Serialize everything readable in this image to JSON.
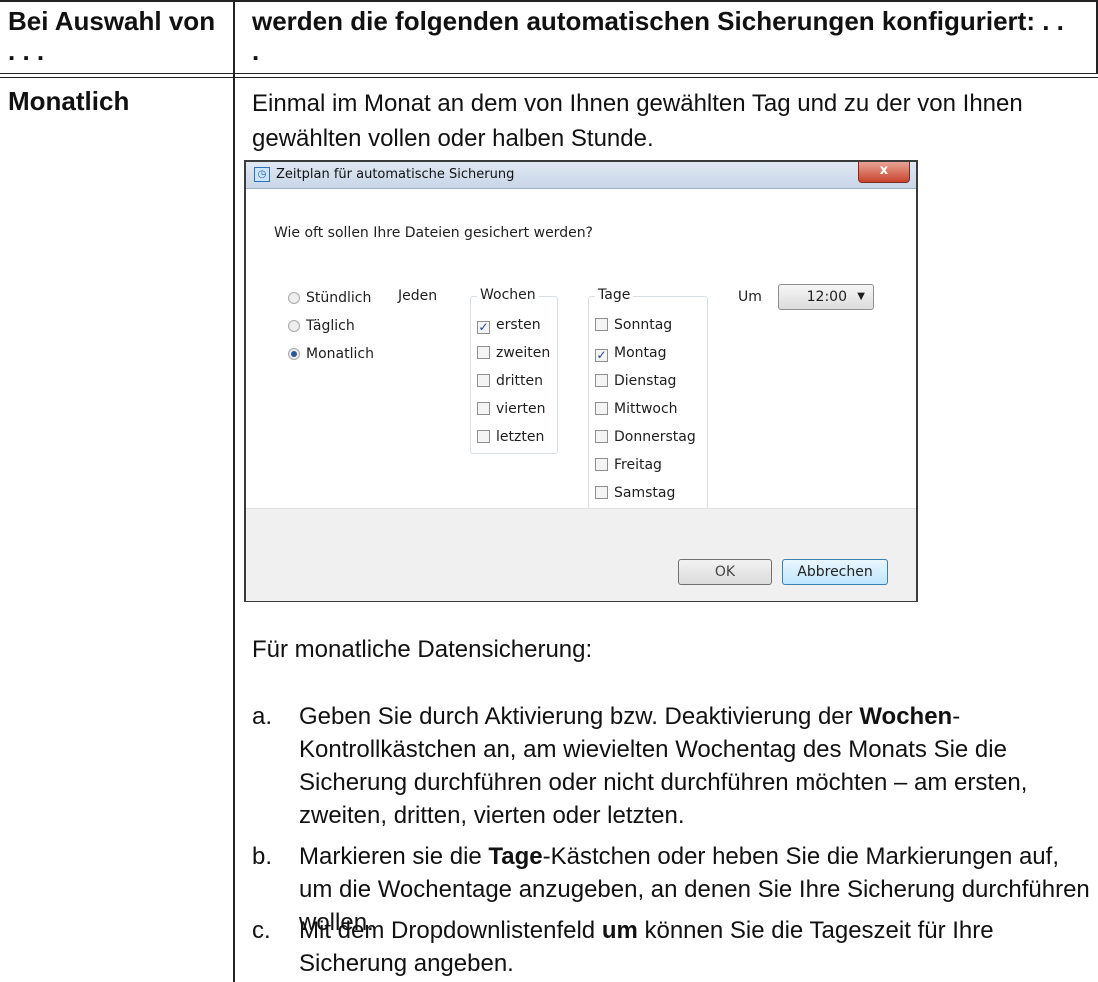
{
  "table": {
    "header_left": "Bei Auswahl von . . .",
    "header_right": "werden die folgenden automatischen Sicherungen konfiguriert: . . .",
    "row_label": "Monatlich",
    "intro": "Einmal im Monat an dem von Ihnen gewählten Tag und zu der von Ihnen gewählten vollen oder halben Stunde."
  },
  "dialog": {
    "title": "Zeitplan für automatische Sicherung",
    "close_label": "x",
    "question": "Wie oft sollen Ihre Dateien gesichert werden?",
    "frequency": [
      {
        "label": "Stündlich",
        "selected": false
      },
      {
        "label": "Täglich",
        "selected": false
      },
      {
        "label": "Monatlich",
        "selected": true
      }
    ],
    "jeden_label": "Jeden",
    "weeks_title": "Wochen",
    "weeks": [
      {
        "label": "ersten",
        "checked": true
      },
      {
        "label": "zweiten",
        "checked": false
      },
      {
        "label": "dritten",
        "checked": false
      },
      {
        "label": "vierten",
        "checked": false
      },
      {
        "label": "letzten",
        "checked": false
      }
    ],
    "days_title": "Tage",
    "days": [
      {
        "label": "Sonntag",
        "checked": false
      },
      {
        "label": "Montag",
        "checked": true
      },
      {
        "label": "Dienstag",
        "checked": false
      },
      {
        "label": "Mittwoch",
        "checked": false
      },
      {
        "label": "Donnerstag",
        "checked": false
      },
      {
        "label": "Freitag",
        "checked": false
      },
      {
        "label": "Samstag",
        "checked": false
      }
    ],
    "um_label": "Um",
    "time_value": "12:00",
    "ok_label": "OK",
    "cancel_label": "Abbrechen"
  },
  "instructions": {
    "heading": "Für monatliche Datensicherung:",
    "items": [
      {
        "marker": "a.",
        "before": "Geben Sie durch Aktivierung bzw. Deaktivierung der ",
        "bold": "Wochen",
        "after": "-Kontrollkästchen an, am wievielten Wochentag des Monats Sie die Sicherung durchführen oder nicht durchführen möchten – am ersten, zweiten, dritten, vierten oder letzten."
      },
      {
        "marker": "b.",
        "before": "Markieren sie die ",
        "bold": "Tage",
        "after": "-Kästchen oder heben Sie die Markierungen auf, um die Wochentage anzugeben, an denen Sie Ihre Sicherung durchführen wollen."
      },
      {
        "marker": "c.",
        "before": "Mit dem Dropdownlistenfeld ",
        "bold": "um",
        "after": " können Sie die Tageszeit für Ihre Sicherung angeben."
      }
    ]
  }
}
